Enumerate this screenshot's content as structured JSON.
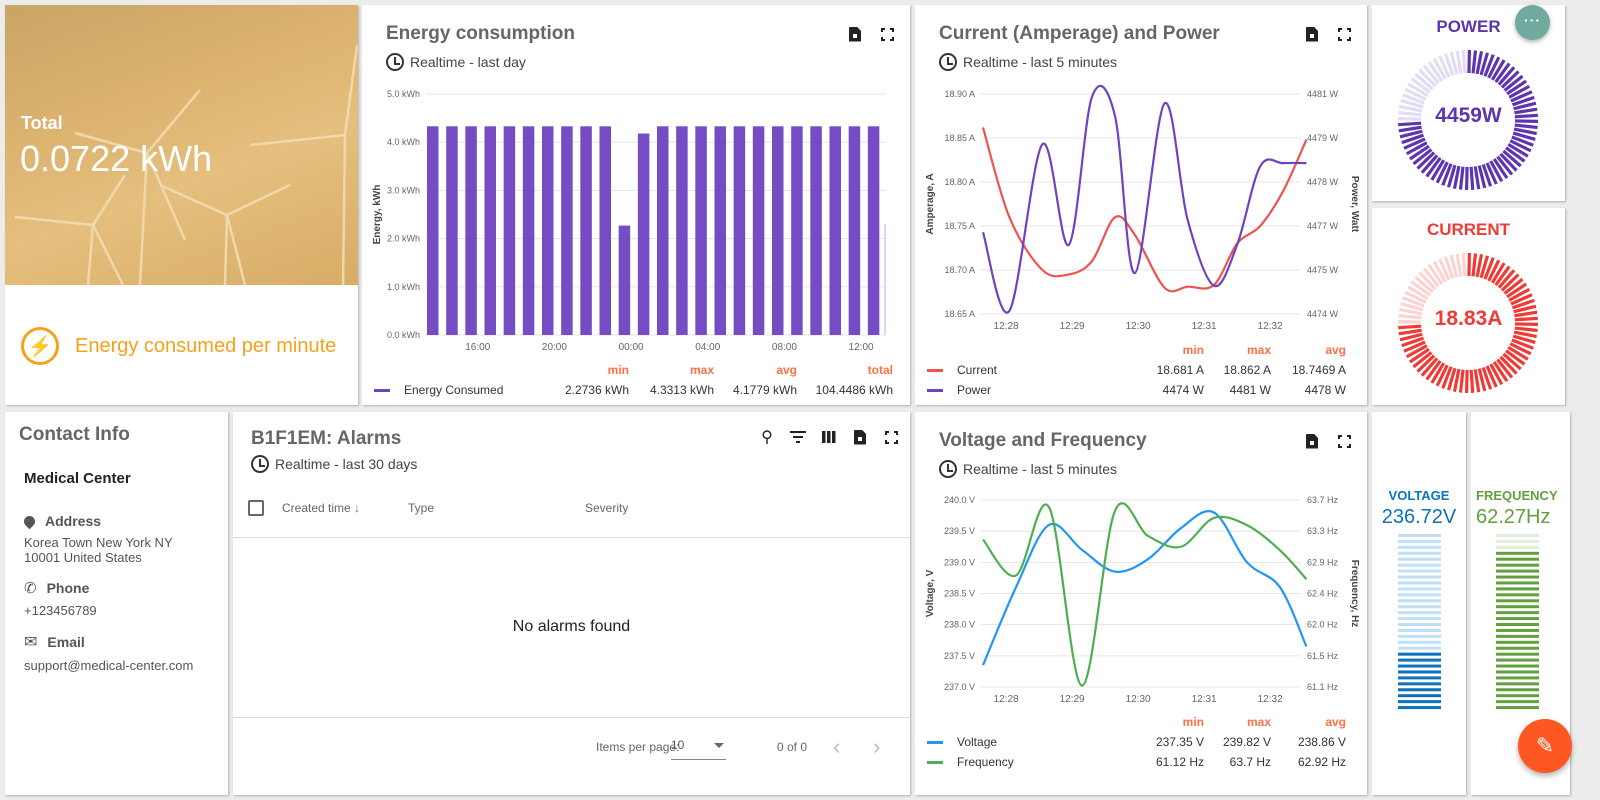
{
  "energy_total": {
    "label": "Total",
    "value": "0.0722 kWh",
    "caption": "Energy consumed per minute",
    "icon": "bolt-icon",
    "accent": "#f7a11a"
  },
  "energy_chart": {
    "title": "Energy consumption",
    "timewindow": "Realtime - last day",
    "legend": {
      "headers": [
        "min",
        "max",
        "avg",
        "total"
      ],
      "rows": [
        {
          "name": "Energy Consumed",
          "color": "#6f42c1",
          "min": "2.2736 kWh",
          "max": "4.3313 kWh",
          "avg": "4.1779 kWh",
          "total": "104.4486 kWh"
        }
      ]
    }
  },
  "current_power_chart": {
    "title": "Current (Amperage) and Power",
    "timewindow": "Realtime - last 5 minutes",
    "legend": {
      "headers": [
        "min",
        "max",
        "avg"
      ],
      "rows": [
        {
          "name": "Current",
          "color": "#ef5350",
          "min": "18.681 A",
          "max": "18.862 A",
          "avg": "18.7469 A"
        },
        {
          "name": "Power",
          "color": "#6f42c1",
          "min": "4474 W",
          "max": "4481 W",
          "avg": "4478 W"
        }
      ]
    }
  },
  "voltage_frequency_chart": {
    "title": "Voltage and Frequency",
    "timewindow": "Realtime - last 5 minutes",
    "legend": {
      "headers": [
        "min",
        "max",
        "avg"
      ],
      "rows": [
        {
          "name": "Voltage",
          "color": "#2196f3",
          "min": "237.35 V",
          "max": "239.82 V",
          "avg": "238.86 V"
        },
        {
          "name": "Frequency",
          "color": "#4caf50",
          "min": "61.12 Hz",
          "max": "63.7 Hz",
          "avg": "62.92 Hz"
        }
      ]
    }
  },
  "gauges": {
    "power": {
      "title": "POWER",
      "value": "4459W",
      "fraction": 0.75,
      "color": "#5e35b1",
      "light": "#e3dcf2"
    },
    "current": {
      "title": "CURRENT",
      "value": "18.83A",
      "fraction": 0.75,
      "color": "#ef3b36",
      "light": "#fbd3d2"
    },
    "voltage": {
      "title": "VOLTAGE",
      "value": "236.72V",
      "fraction": 0.33,
      "color": "#0b72bb",
      "light": "#bfe0f8"
    },
    "frequency": {
      "title": "FREQUENCY",
      "value": "62.27Hz",
      "fraction": 0.88,
      "color": "#62a03c",
      "light": "#e1ecd9"
    }
  },
  "contact": {
    "title": "Contact Info",
    "org": "Medical Center",
    "address_label": "Address",
    "address_line1": "Korea Town New York NY",
    "address_line2": "10001 United States",
    "phone_label": "Phone",
    "phone": "+123456789",
    "email_label": "Email",
    "email": "support@medical-center.com"
  },
  "alarms": {
    "title": "B1F1EM: Alarms",
    "timewindow": "Realtime - last 30 days",
    "columns": [
      "Created time",
      "Type",
      "Severity"
    ],
    "empty_text": "No alarms found",
    "items_per_page_label": "Items per page:",
    "items_per_page": "10",
    "range": "0 of 0"
  },
  "chart_data": [
    {
      "type": "bar",
      "title": "Energy consumption",
      "xlabel": "",
      "ylabel": "Energy, kWh",
      "ylim": [
        0,
        5
      ],
      "yticks": [
        "0.0 kWh",
        "1.0 kWh",
        "2.0 kWh",
        "3.0 kWh",
        "4.0 kWh",
        "5.0 kWh"
      ],
      "xticks": [
        "16:00",
        "20:00",
        "00:00",
        "04:00",
        "08:00",
        "12:00"
      ],
      "series": [
        {
          "name": "Energy Consumed",
          "values": [
            4.33,
            4.33,
            4.33,
            4.33,
            4.33,
            4.33,
            4.33,
            4.33,
            4.33,
            4.33,
            2.27,
            4.18,
            4.33,
            4.33,
            4.33,
            4.33,
            4.33,
            4.33,
            4.33,
            4.33,
            4.33,
            4.33,
            4.33,
            4.33,
            2.3
          ]
        }
      ],
      "grid": true
    },
    {
      "type": "line",
      "title": "Current (Amperage) and Power",
      "ylabel": "Amperage, A",
      "ylabel_right": "Power, Watt",
      "ylim": [
        18.65,
        18.9
      ],
      "ylim_right": [
        4474,
        4481
      ],
      "yticks": [
        "18.65 A",
        "18.70 A",
        "18.75 A",
        "18.80 A",
        "18.85 A",
        "18.90 A"
      ],
      "yticks_right": [
        "4474 W",
        "4475 W",
        "4477 W",
        "4478 W",
        "4479 W",
        "4481 W"
      ],
      "xticks": [
        "12:28",
        "12:29",
        "12:30",
        "12:31",
        "12:32"
      ],
      "x": [
        0,
        0.4,
        0.9,
        1.3,
        1.65,
        2.0,
        2.3,
        2.75,
        3.1,
        3.5,
        3.85,
        4.2,
        4.55,
        4.9
      ],
      "series": [
        {
          "name": "Current",
          "axis": "left",
          "values": [
            18.862,
            18.76,
            18.7,
            18.695,
            18.71,
            18.76,
            18.74,
            18.68,
            18.681,
            18.683,
            18.73,
            18.75,
            18.79,
            18.848
          ]
        },
        {
          "name": "Power",
          "axis": "right",
          "values": [
            4476.6,
            4474.1,
            4479.4,
            4476.2,
            4480.9,
            4480.3,
            4475.3,
            4480.7,
            4477.0,
            4474.9,
            4476.2,
            4478.7,
            4478.8,
            4478.8
          ]
        }
      ],
      "grid": true
    },
    {
      "type": "line",
      "title": "Voltage and Frequency",
      "ylabel": "Voltage, V",
      "ylabel_right": "Frequency, Hz",
      "ylim": [
        237.0,
        240.0
      ],
      "ylim_right": [
        61.1,
        63.7
      ],
      "yticks": [
        "237.0 V",
        "237.5 V",
        "238.0 V",
        "238.5 V",
        "239.0 V",
        "239.5 V",
        "240.0 V"
      ],
      "yticks_right": [
        "61.1 Hz",
        "61.5 Hz",
        "62.0 Hz",
        "62.4 Hz",
        "62.9 Hz",
        "63.3 Hz",
        "63.7 Hz"
      ],
      "xticks": [
        "12:28",
        "12:29",
        "12:30",
        "12:31",
        "12:32"
      ],
      "x": [
        0,
        0.5,
        1.0,
        1.5,
        2.0,
        2.5,
        3.0,
        3.5,
        4.0,
        4.5,
        4.9
      ],
      "series": [
        {
          "name": "Voltage",
          "axis": "left",
          "values": [
            237.35,
            238.6,
            239.6,
            239.2,
            238.85,
            239.05,
            239.55,
            239.8,
            239.0,
            238.6,
            237.65
          ]
        },
        {
          "name": "Frequency",
          "axis": "right",
          "values": [
            63.15,
            62.65,
            63.6,
            61.12,
            63.55,
            63.2,
            63.05,
            63.45,
            63.35,
            63.0,
            62.6
          ]
        }
      ],
      "grid": true
    }
  ],
  "fab": {
    "edit_icon": "pencil-icon",
    "more_icon": "more-horiz-icon"
  }
}
